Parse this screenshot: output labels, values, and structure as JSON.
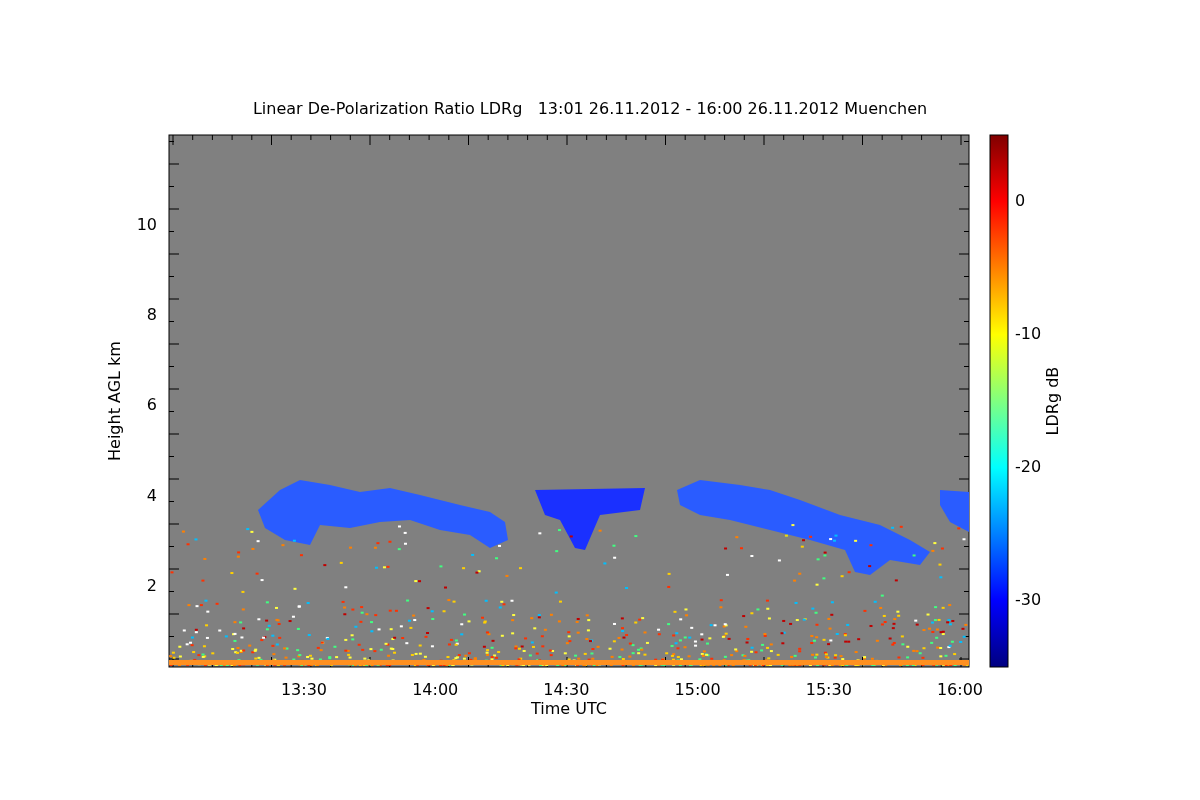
{
  "plot": {
    "title": "Linear De-Polarization Ratio LDRg   13:01 26.11.2012 - 16:00 26.11.2012 Muenchen",
    "ylabel": "Height AGL km",
    "xlabel": "Time UTC",
    "yticks": [
      "10",
      "8",
      "6",
      "4",
      "2"
    ],
    "xticks": [
      "13:30",
      "14:00",
      "14:30",
      "15:00",
      "15:30",
      "16:00"
    ]
  },
  "colorbar": {
    "label": "LDRg dB",
    "ticks": [
      "0",
      "-10",
      "-20",
      "-30"
    ]
  }
}
